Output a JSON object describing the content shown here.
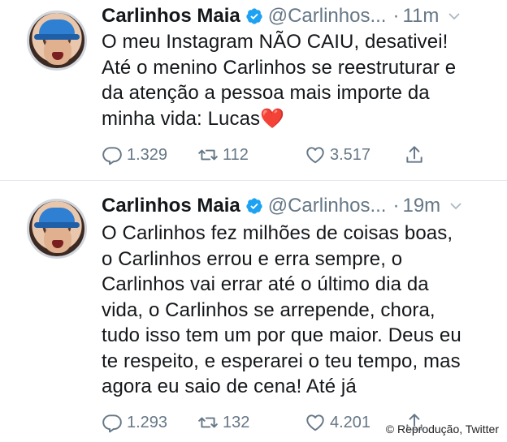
{
  "tweets": [
    {
      "name": "Carlinhos Maia",
      "handle": "@Carlinhos...",
      "separator": "·",
      "time": "11m",
      "lines": [
        "O meu Instagram NÃO CAIU, desativei!",
        "Até o menino Carlinhos se reestruturar e",
        "da atenção a pessoa mais importe da",
        "minha vida: Lucas"
      ],
      "emoji": "❤️",
      "replies": "1.329",
      "retweets": "112",
      "likes": "3.517",
      "icons": [
        "reply-icon",
        "retweet-icon",
        "like-icon",
        "share-icon"
      ]
    },
    {
      "name": "Carlinhos Maia",
      "handle": "@Carlinhos...",
      "separator": "·",
      "time": "19m",
      "lines": [
        "O Carlinhos fez milhões de coisas boas,",
        "o Carlinhos errou e erra sempre, o",
        "Carlinhos vai errar até o último dia da",
        "vida, o Carlinhos se arrepende, chora,",
        "tudo isso tem um por que maior. Deus eu",
        "te respeito, e esperarei o teu tempo, mas",
        "agora eu saio de cena! Até já"
      ],
      "replies": "1.293",
      "retweets": "132",
      "likes": "4.201",
      "icons": [
        "reply-icon",
        "retweet-icon",
        "like-icon",
        "share-icon"
      ]
    }
  ],
  "credit": "© Reprodução, Twitter",
  "colors": {
    "text": "#14171a",
    "secondary": "#657786",
    "verified": "#1da1f2",
    "heart": "#e0245e"
  }
}
